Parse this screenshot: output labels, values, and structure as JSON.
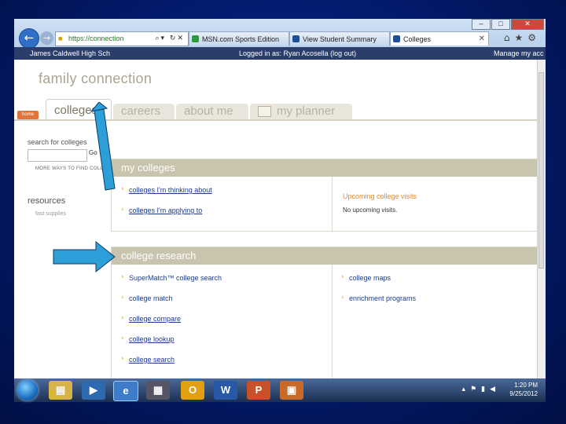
{
  "browser": {
    "address_url": "https://connection",
    "tabs": [
      {
        "label": "MSN.com Sports Edition"
      },
      {
        "label": "View Student Summary"
      },
      {
        "label": "Colleges"
      }
    ]
  },
  "sitebar": {
    "school": "James Caldwell High Sch",
    "login": "Logged in as: Ryan Acosella (log out)",
    "manage": "Manage my acc"
  },
  "page": {
    "brand": "family connection",
    "home_tab": "home",
    "tabs": [
      "colleges",
      "careers",
      "about me",
      "my planner"
    ],
    "search_label": "search for colleges",
    "go_label": "Go",
    "more_ways": "MORE WAYS TO FIND COLLEGES >>",
    "resources_title": "resources",
    "resources_link": "fast supplies"
  },
  "my_colleges": {
    "title": "my colleges",
    "links": [
      "colleges I'm thinking about",
      "colleges I'm applying to"
    ],
    "upcoming_title": "Upcoming college visits",
    "upcoming_text": "No upcoming visits."
  },
  "college_research": {
    "title": "college research",
    "left_links": [
      "SuperMatch™ college search",
      "college match",
      "college compare",
      "college lookup",
      "college search"
    ],
    "right_links": [
      "college maps",
      "enrichment programs"
    ]
  },
  "taskbar": {
    "time": "1:20 PM",
    "date": "9/25/2012"
  },
  "colors": {
    "section_header": "#c9c4ad",
    "link": "#1a3b8c",
    "accent_orange": "#e09a2a",
    "slide_background": "#031a6a",
    "annotation_arrow": "#2d9fd8"
  }
}
